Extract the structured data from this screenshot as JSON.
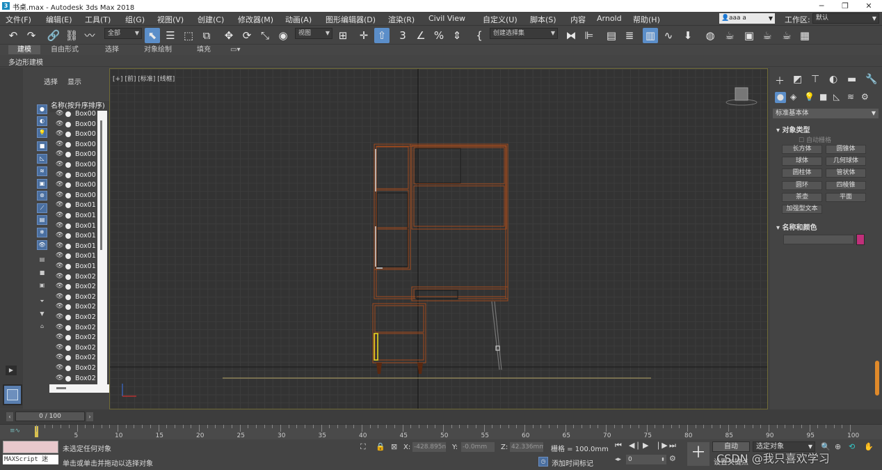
{
  "window": {
    "title": "书桌.max - Autodesk 3ds Max 2018",
    "controls": [
      "─",
      "❐",
      "✕"
    ]
  },
  "menus": [
    "文件(F)",
    "编辑(E)",
    "工具(T)",
    "组(G)",
    "视图(V)",
    "创建(C)",
    "修改器(M)",
    "动画(A)",
    "图形编辑器(D)",
    "渲染(R)",
    "Civil View",
    "自定义(U)",
    "脚本(S)",
    "内容",
    "Arnold",
    "帮助(H)"
  ],
  "user": {
    "name": "aaa a",
    "workspace_label": "工作区:",
    "workspace_value": "默认"
  },
  "toolbar": {
    "selection_filter": "全部",
    "reference_coord": "视图",
    "named_selection": "创建选择集"
  },
  "ribbon": {
    "tabs": [
      "建模",
      "自由形式",
      "选择",
      "对象绘制",
      "填充"
    ],
    "sub_label": "多边形建模"
  },
  "scene_explorer": {
    "tabs": [
      "选择",
      "显示"
    ],
    "column_header": "名称(按升序排序)",
    "objects": [
      "Box00",
      "Box00",
      "Box00",
      "Box00",
      "Box00",
      "Box00",
      "Box00",
      "Box00",
      "Box00",
      "Box01",
      "Box01",
      "Box01",
      "Box01",
      "Box01",
      "Box01",
      "Box01",
      "Box02",
      "Box02",
      "Box02",
      "Box02",
      "Box02",
      "Box02",
      "Box02",
      "Box02",
      "Box02",
      "Box02",
      "Box02"
    ]
  },
  "viewport": {
    "labels": [
      "[+]",
      "[前]",
      "[标准]",
      "[线框]"
    ]
  },
  "command_panel": {
    "category": "标准基本体",
    "rollout_object_type": "对象类型",
    "autogrid": "自动栅格",
    "buttons": [
      "长方体",
      "圆锥体",
      "球体",
      "几何球体",
      "圆柱体",
      "管状体",
      "圆环",
      "四棱锥",
      "茶壶",
      "平面",
      "加强型文本"
    ],
    "rollout_name_color": "名称和颜色",
    "object_color": "#c0307a"
  },
  "timeline": {
    "frame_display": "0 / 100",
    "ticks": [
      "0",
      "5",
      "10",
      "15",
      "20",
      "25",
      "30",
      "35",
      "40",
      "45",
      "50",
      "55",
      "60",
      "65",
      "70",
      "75",
      "80",
      "85",
      "90",
      "95",
      "100"
    ]
  },
  "status": {
    "maxscript": "MAXScript 迷",
    "prompt_line1": "未选定任何对象",
    "prompt_line2": "单击或单击并拖动以选择对象",
    "x_label": "X:",
    "x_value": "-428.895n",
    "y_label": "Y:",
    "y_value": "-0.0mm",
    "z_label": "Z:",
    "z_value": "42.336mm",
    "grid": "栅格 = 100.0mm",
    "add_time_tag": "添加时间标记",
    "auto_key": "自动",
    "key_filter": "选定对象",
    "set_key": "设置关键点",
    "frame_input": "0",
    "watermark": "CSDN @我只喜欢学习"
  }
}
